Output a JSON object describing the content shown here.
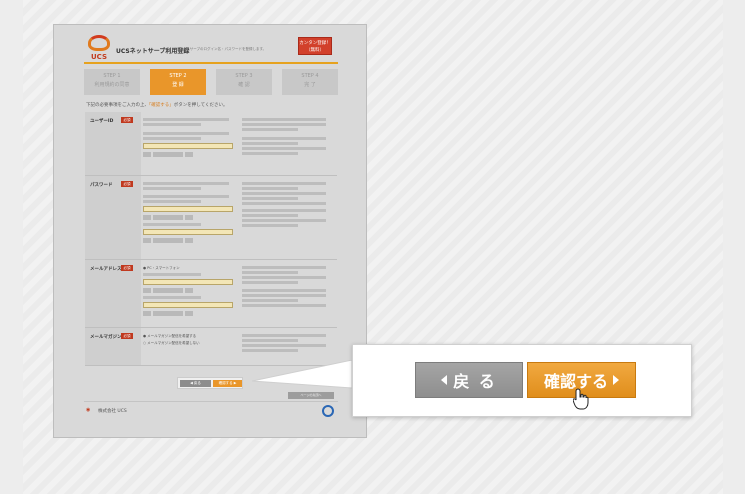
{
  "header": {
    "logo_text": "UCS",
    "title": "UCSネットサーブ利用登録",
    "subtitle": "UCSネットサーブのログイン名・パスワードを登録します。",
    "simple_button": "カンタン登録！（無料）"
  },
  "steps": [
    {
      "num": "STEP 1",
      "label": "利用規約の同意",
      "active": false
    },
    {
      "num": "STEP 2",
      "label": "登 録",
      "active": true
    },
    {
      "num": "STEP 3",
      "label": "確 認",
      "active": false
    },
    {
      "num": "STEP 4",
      "label": "完 了",
      "active": false
    }
  ],
  "intro": {
    "before": "下記の必要事項をご入力の上、",
    "highlight": "「確認する」",
    "after": "ボタンを押してください。"
  },
  "form": {
    "required_badge": "必須",
    "rows": [
      {
        "label": "ユーザーID"
      },
      {
        "label": "パスワード"
      },
      {
        "label": "メールアドレス"
      },
      {
        "label": "メールマガジン"
      }
    ],
    "radio_pc": "PC・スマートフォン",
    "radio_mag_yes": "メールマガジン配信を希望する",
    "radio_mag_no": "メールマガジン配信を希望しない"
  },
  "footer": {
    "back_small": "◀ 戻る",
    "confirm_small": "確認する ▶",
    "pagetop": "ページの先頭へ",
    "corp_name": "株式会社 UCS"
  },
  "callout": {
    "back_label": "戻 る",
    "confirm_label": "確認する"
  },
  "colors": {
    "accent": "#e9962a",
    "required": "#c0391f",
    "gray_button": "#8e8e8e"
  }
}
